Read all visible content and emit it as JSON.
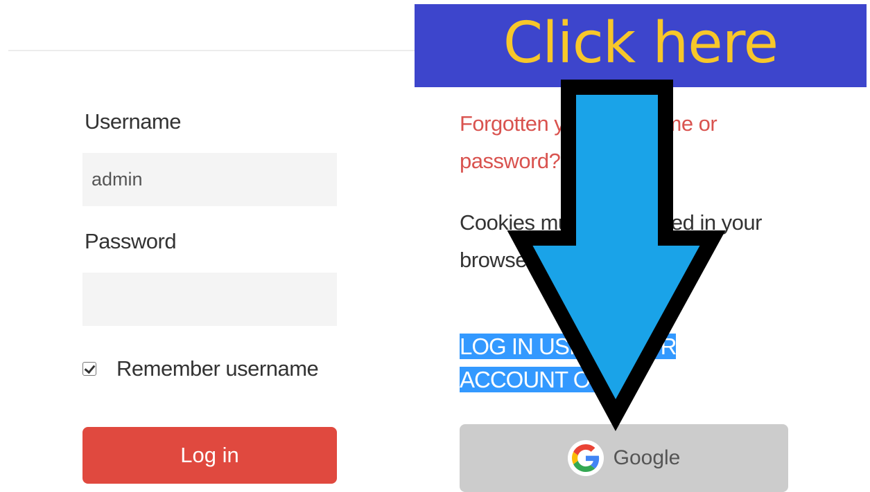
{
  "login_form": {
    "username_label": "Username",
    "username_value": "admin",
    "password_label": "Password",
    "password_value": "",
    "remember_label": "Remember username",
    "remember_checked": true,
    "login_button": "Log in"
  },
  "help": {
    "forgot_link": "Forgotten your username or password?",
    "cookies_notice": "Cookies must be enabled in your browser"
  },
  "oauth": {
    "heading_line1": "LOG IN USING YOUR",
    "heading_line2": "ACCOUNT ON:",
    "google_label": "Google",
    "google_icon": "google-g-icon"
  },
  "annotation": {
    "banner_text": "Click here",
    "banner_color": "#3d45cc",
    "banner_text_color": "#f7c72a",
    "arrow_color": "#1aa3e8",
    "arrow_icon": "down-arrow-icon"
  },
  "colors": {
    "login_button": "#e0493f",
    "link": "#d9534f",
    "selection_highlight": "#3399ff",
    "google_button": "#cccccc"
  }
}
